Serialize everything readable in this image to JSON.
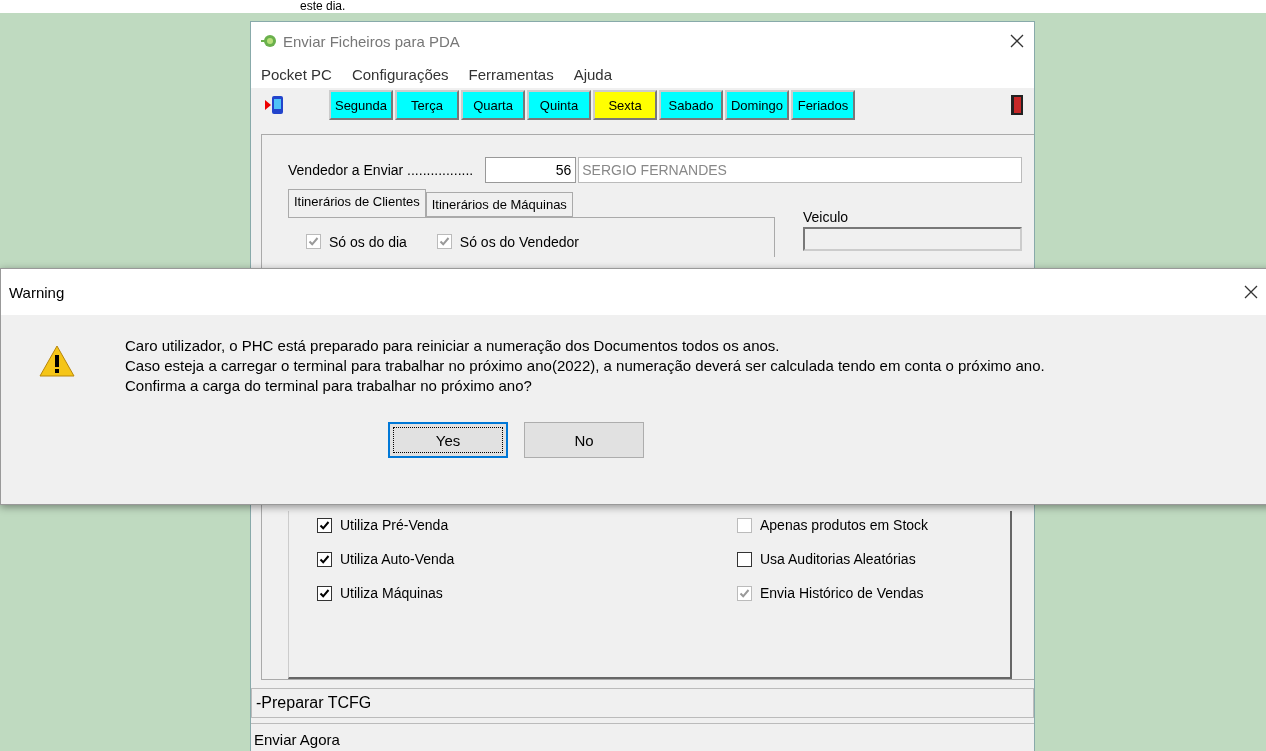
{
  "page_top_text": "este dia.",
  "window": {
    "title": "Enviar Ficheiros para PDA"
  },
  "menu": [
    "Pocket PC",
    "Configurações",
    "Ferramentas",
    "Ajuda"
  ],
  "day_buttons": [
    {
      "label": "Segunda",
      "selected": false
    },
    {
      "label": "Terça",
      "selected": false
    },
    {
      "label": "Quarta",
      "selected": false
    },
    {
      "label": "Quinta",
      "selected": false
    },
    {
      "label": "Sexta",
      "selected": true
    },
    {
      "label": "Sabado",
      "selected": false
    },
    {
      "label": "Domingo",
      "selected": false
    },
    {
      "label": "Feriados",
      "selected": false
    }
  ],
  "vendedor": {
    "label": "Vendedor a Enviar .................",
    "number": "56",
    "name": "SERGIO FERNANDES"
  },
  "tabs": [
    {
      "label": "Itinerários de Clientes",
      "selected": true
    },
    {
      "label": "Itinerários de Máquinas",
      "selected": false
    }
  ],
  "filters": [
    {
      "label": "Só os do dia",
      "checked": true,
      "disabled": true
    },
    {
      "label": "Só os do Vendedor",
      "checked": true,
      "disabled": true
    }
  ],
  "veiculo": {
    "label": "Veiculo"
  },
  "options": [
    {
      "label": "Utiliza Pré-Venda",
      "checked": true,
      "disabled": false
    },
    {
      "label": "Apenas produtos em Stock",
      "checked": false,
      "disabled": true
    },
    {
      "label": "Utiliza Auto-Venda",
      "checked": true,
      "disabled": false
    },
    {
      "label": "Usa Auditorias Aleatórias",
      "checked": false,
      "disabled": false
    },
    {
      "label": "Utiliza Máquinas",
      "checked": true,
      "disabled": false
    },
    {
      "label": "Envia Histórico de Vendas",
      "checked": true,
      "disabled": true
    }
  ],
  "progress_field": "-Preparar TCFG",
  "status_bar": "Enviar Agora",
  "dialog": {
    "title": "Warning",
    "message": [
      "Caro utilizador, o PHC está preparado para reiniciar a numeração dos Documentos todos os anos.",
      "Caso esteja a carregar o terminal para trabalhar no próximo ano(2022), a numeração deverá ser calculada tendo em conta o próximo ano.",
      "Confirma a carga do terminal para trabalhar no próximo ano?"
    ],
    "buttons": [
      {
        "label": "Yes",
        "selected": true
      },
      {
        "label": "No",
        "selected": false
      }
    ]
  }
}
